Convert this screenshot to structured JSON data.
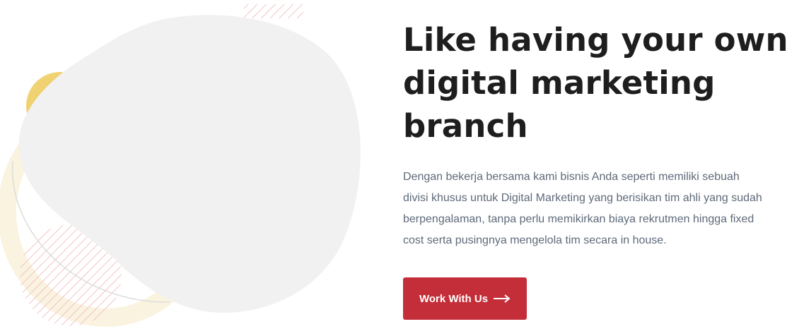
{
  "hero": {
    "headline_lines": [
      "Like having your own",
      "digital marketing",
      "branch"
    ],
    "description_lines": [
      "Dengan bekerja bersama kami bisnis Anda seperti memiliki sebuah",
      "divisi khusus untuk Digital Marketing yang berisikan tim ahli yang sudah",
      "berpengalaman, tanpa perlu memikirkan biaya rekrutmen hingga fixed",
      "cost serta pusingnya mengelola tim secara in house."
    ],
    "cta_label": "Work With Us",
    "cta_icon": "arrow-right-icon"
  },
  "colors": {
    "accent": "#c42e39",
    "heading": "#1e1e1e",
    "body_text": "#5f6a7a",
    "blob": "#f1f1f1",
    "gold": "#f0d070",
    "stripes": "#f2c4c6"
  }
}
